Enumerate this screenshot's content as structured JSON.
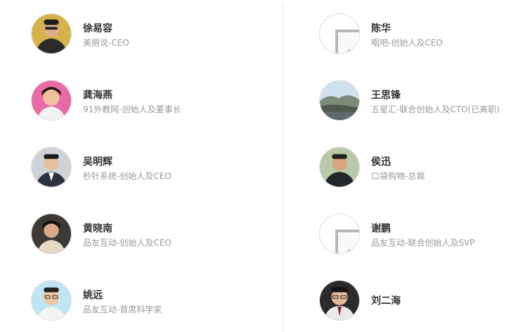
{
  "people": {
    "left": [
      {
        "name": "徐易容",
        "title": "美丽说-CEO",
        "avatar_icon": "person-photo-icon"
      },
      {
        "name": "龚海燕",
        "title": "91外教网-创始人及董事长",
        "avatar_icon": "person-photo-icon"
      },
      {
        "name": "吴明辉",
        "title": "秒针系统-创始人及CEO",
        "avatar_icon": "person-photo-icon"
      },
      {
        "name": "黄晓南",
        "title": "品友互动-创始人及CEO",
        "avatar_icon": "person-photo-icon"
      },
      {
        "name": "姚远",
        "title": "品友互动-首席科学家",
        "avatar_icon": "person-photo-icon"
      }
    ],
    "right": [
      {
        "name": "陈华",
        "title": "唱吧-创始人及CEO",
        "avatar_icon": "broken-image-icon"
      },
      {
        "name": "王思锋",
        "title": "五星汇-联合创始人及CTO(已离职)",
        "avatar_icon": "landscape-photo-icon"
      },
      {
        "name": "侯迅",
        "title": "口袋购物-总裁",
        "avatar_icon": "person-photo-icon"
      },
      {
        "name": "谢鹏",
        "title": "品友互动-联合创始人及SVP",
        "avatar_icon": "broken-image-icon"
      },
      {
        "name": "刘二海",
        "title": "",
        "avatar_icon": "person-photo-icon"
      }
    ]
  },
  "colors": {
    "name": "#333333",
    "title": "#999999",
    "divider": "#e6e6e6"
  }
}
